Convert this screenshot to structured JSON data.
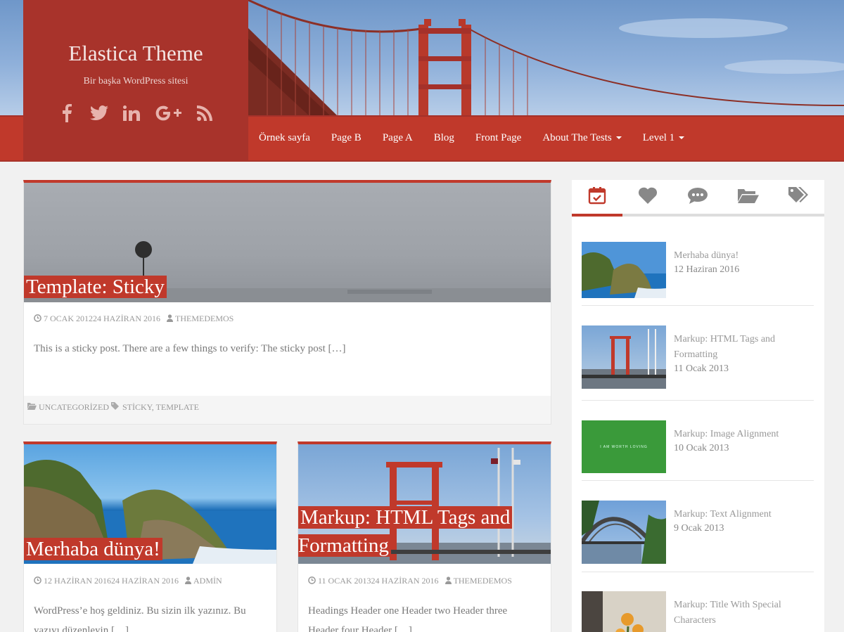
{
  "site": {
    "title": "Elastica Theme",
    "tagline": "Bir başka WordPress sitesi",
    "social": [
      "facebook-icon",
      "twitter-icon",
      "linkedin-icon",
      "google-plus-icon",
      "rss-icon"
    ]
  },
  "nav": {
    "items": [
      {
        "label": "Örnek sayfa"
      },
      {
        "label": "Page B"
      },
      {
        "label": "Page A"
      },
      {
        "label": "Blog"
      },
      {
        "label": "Front Page"
      },
      {
        "label": "About The Tests",
        "dropdown": true
      },
      {
        "label": "Level 1",
        "dropdown": true
      }
    ]
  },
  "posts": [
    {
      "title": "Template: Sticky",
      "date": "7 OCAK 201224 HAZİRAN 2016",
      "author": "THEMEDEMOS",
      "excerpt": "This is a sticky post. There are a few things to verify: The sticky post […]",
      "categories": "UNCATEGORİZED",
      "tags": "STİCKY, TEMPLATE"
    },
    {
      "title": "Merhaba dünya!",
      "date": "12 HAZİRAN 201624 HAZİRAN 2016",
      "author": "ADMİN",
      "excerpt": "WordPress’e hoş geldiniz. Bu sizin ilk yazınız. Bu yazıyı düzenleyin […]"
    },
    {
      "title_line1": "Markup: HTML Tags and",
      "title_line2": "Formatting",
      "date": "11 OCAK 201324 HAZİRAN 2016",
      "author": "THEMEDEMOS",
      "excerpt": "Headings Header one Header two Header three Header four Header […]"
    }
  ],
  "sidebar": {
    "tabs": [
      "calendar-check-icon",
      "heart-icon",
      "comments-icon",
      "folder-open-icon",
      "tags-icon"
    ],
    "active_tab": 0,
    "items": [
      {
        "title": "Merhaba dünya!",
        "date": "12 Haziran 2016"
      },
      {
        "title": "Markup: HTML Tags and Formatting",
        "date": "11 Ocak 2013"
      },
      {
        "title": "Markup: Image Alignment",
        "date": "10 Ocak 2013",
        "thumb_text": "I AM WORTH LOVING"
      },
      {
        "title": "Markup: Text Alignment",
        "date": "9 Ocak 2013"
      },
      {
        "title": "Markup: Title With Special Characters",
        "date": ""
      }
    ]
  },
  "colors": {
    "accent": "#c0392b",
    "brand_bg": "#a8332b",
    "page_bg": "#f1f1f1"
  }
}
